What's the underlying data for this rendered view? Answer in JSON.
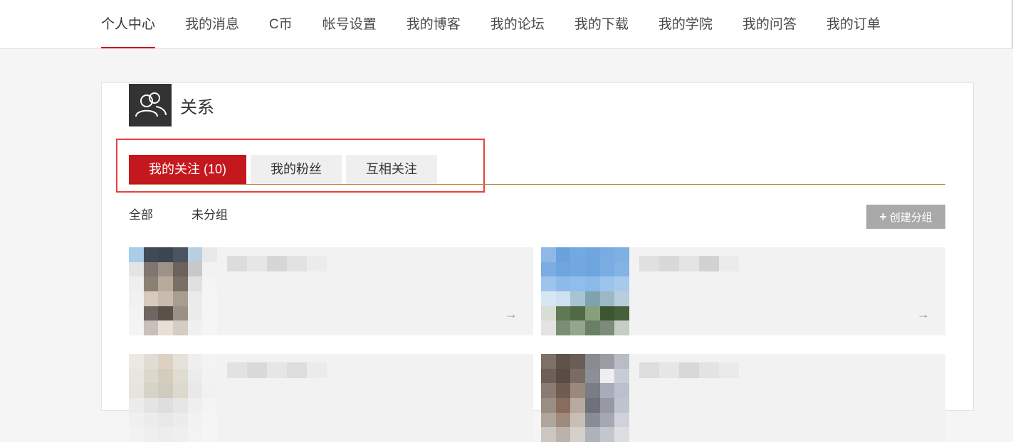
{
  "topnav": {
    "items": [
      "个人中心",
      "我的消息",
      "C币",
      "帐号设置",
      "我的博客",
      "我的论坛",
      "我的下载",
      "我的学院",
      "我的问答",
      "我的订单"
    ],
    "active_index": 0
  },
  "section": {
    "icon": "users-icon",
    "title": "关系"
  },
  "tabs": {
    "items": [
      "我的关注 (10)",
      "我的粉丝",
      "互相关注"
    ],
    "active_index": 0
  },
  "groups": {
    "items": [
      "全部",
      "未分组"
    ]
  },
  "create_group_button": {
    "icon": "plus-icon",
    "label": "创建分组"
  },
  "arrow_glyph": "→",
  "colors": {
    "accent_red": "#c5171e",
    "highlight_red": "#e8403f",
    "tab_underline": "#b58a3c",
    "button_gray": "#a9a9a9"
  }
}
